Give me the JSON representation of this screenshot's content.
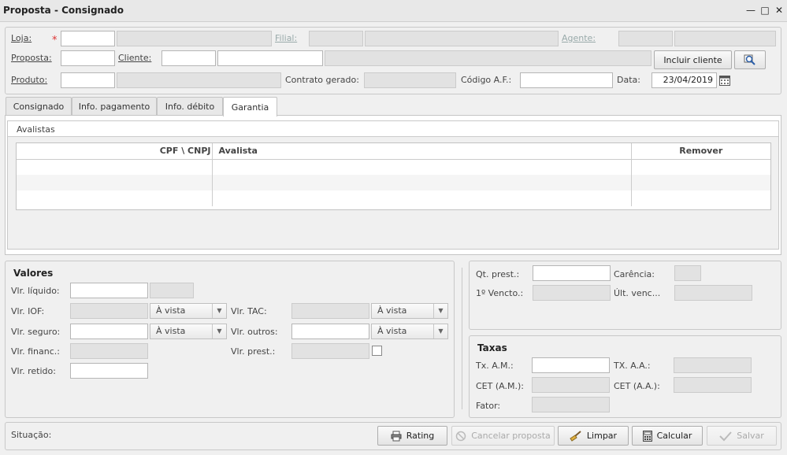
{
  "window": {
    "title": "Proposta - Consignado",
    "minimize": "—",
    "maximize": "□",
    "close": "✕"
  },
  "header": {
    "loja_label": "Loja:",
    "required_mark": "*",
    "filial_label": "Filial:",
    "agente_label": "Agente:",
    "proposta_label": "Proposta:",
    "cliente_label": "Cliente:",
    "incluir_cliente": "Incluir cliente",
    "produto_label": "Produto:",
    "contrato_label": "Contrato gerado:",
    "codigo_label": "Código A.F.:",
    "data_label": "Data:",
    "data_value": "23/04/2019"
  },
  "tabs": [
    {
      "label": "Consignado"
    },
    {
      "label": "Info. pagamento"
    },
    {
      "label": "Info. débito"
    },
    {
      "label": "Garantia"
    }
  ],
  "avalistas": {
    "title": "Avalistas",
    "columns": [
      "CPF \\ CNPJ",
      "Avalista",
      "Remover"
    ]
  },
  "valores": {
    "title": "Valores",
    "liquido_label": "Vlr. líquido:",
    "iof_label": "Vlr. IOF:",
    "seguro_label": "Vlr. seguro:",
    "financ_label": "Vlr. financ.:",
    "retido_label": "Vlr. retido:",
    "tac_label": "Vlr. TAC:",
    "outros_label": "Vlr. outros:",
    "prest_label": "Vlr. prest.:",
    "avista": "À vista"
  },
  "prestacoes": {
    "qt_label": "Qt. prest.:",
    "carencia_label": "Carência:",
    "vencto_label": "1º Vencto.:",
    "ult_label": "Últ. venc..."
  },
  "taxas": {
    "title": "Taxas",
    "tx_am_label": "Tx. A.M.:",
    "tx_aa_label": "TX. A.A.:",
    "cet_am_label": "CET (A.M.):",
    "cet_aa_label": "CET (A.A.):",
    "fator_label": "Fator:"
  },
  "footer": {
    "situacao_label": "Situação:",
    "rating": "Rating",
    "cancelar": "Cancelar proposta",
    "limpar": "Limpar",
    "calcular": "Calcular",
    "salvar": "Salvar"
  }
}
